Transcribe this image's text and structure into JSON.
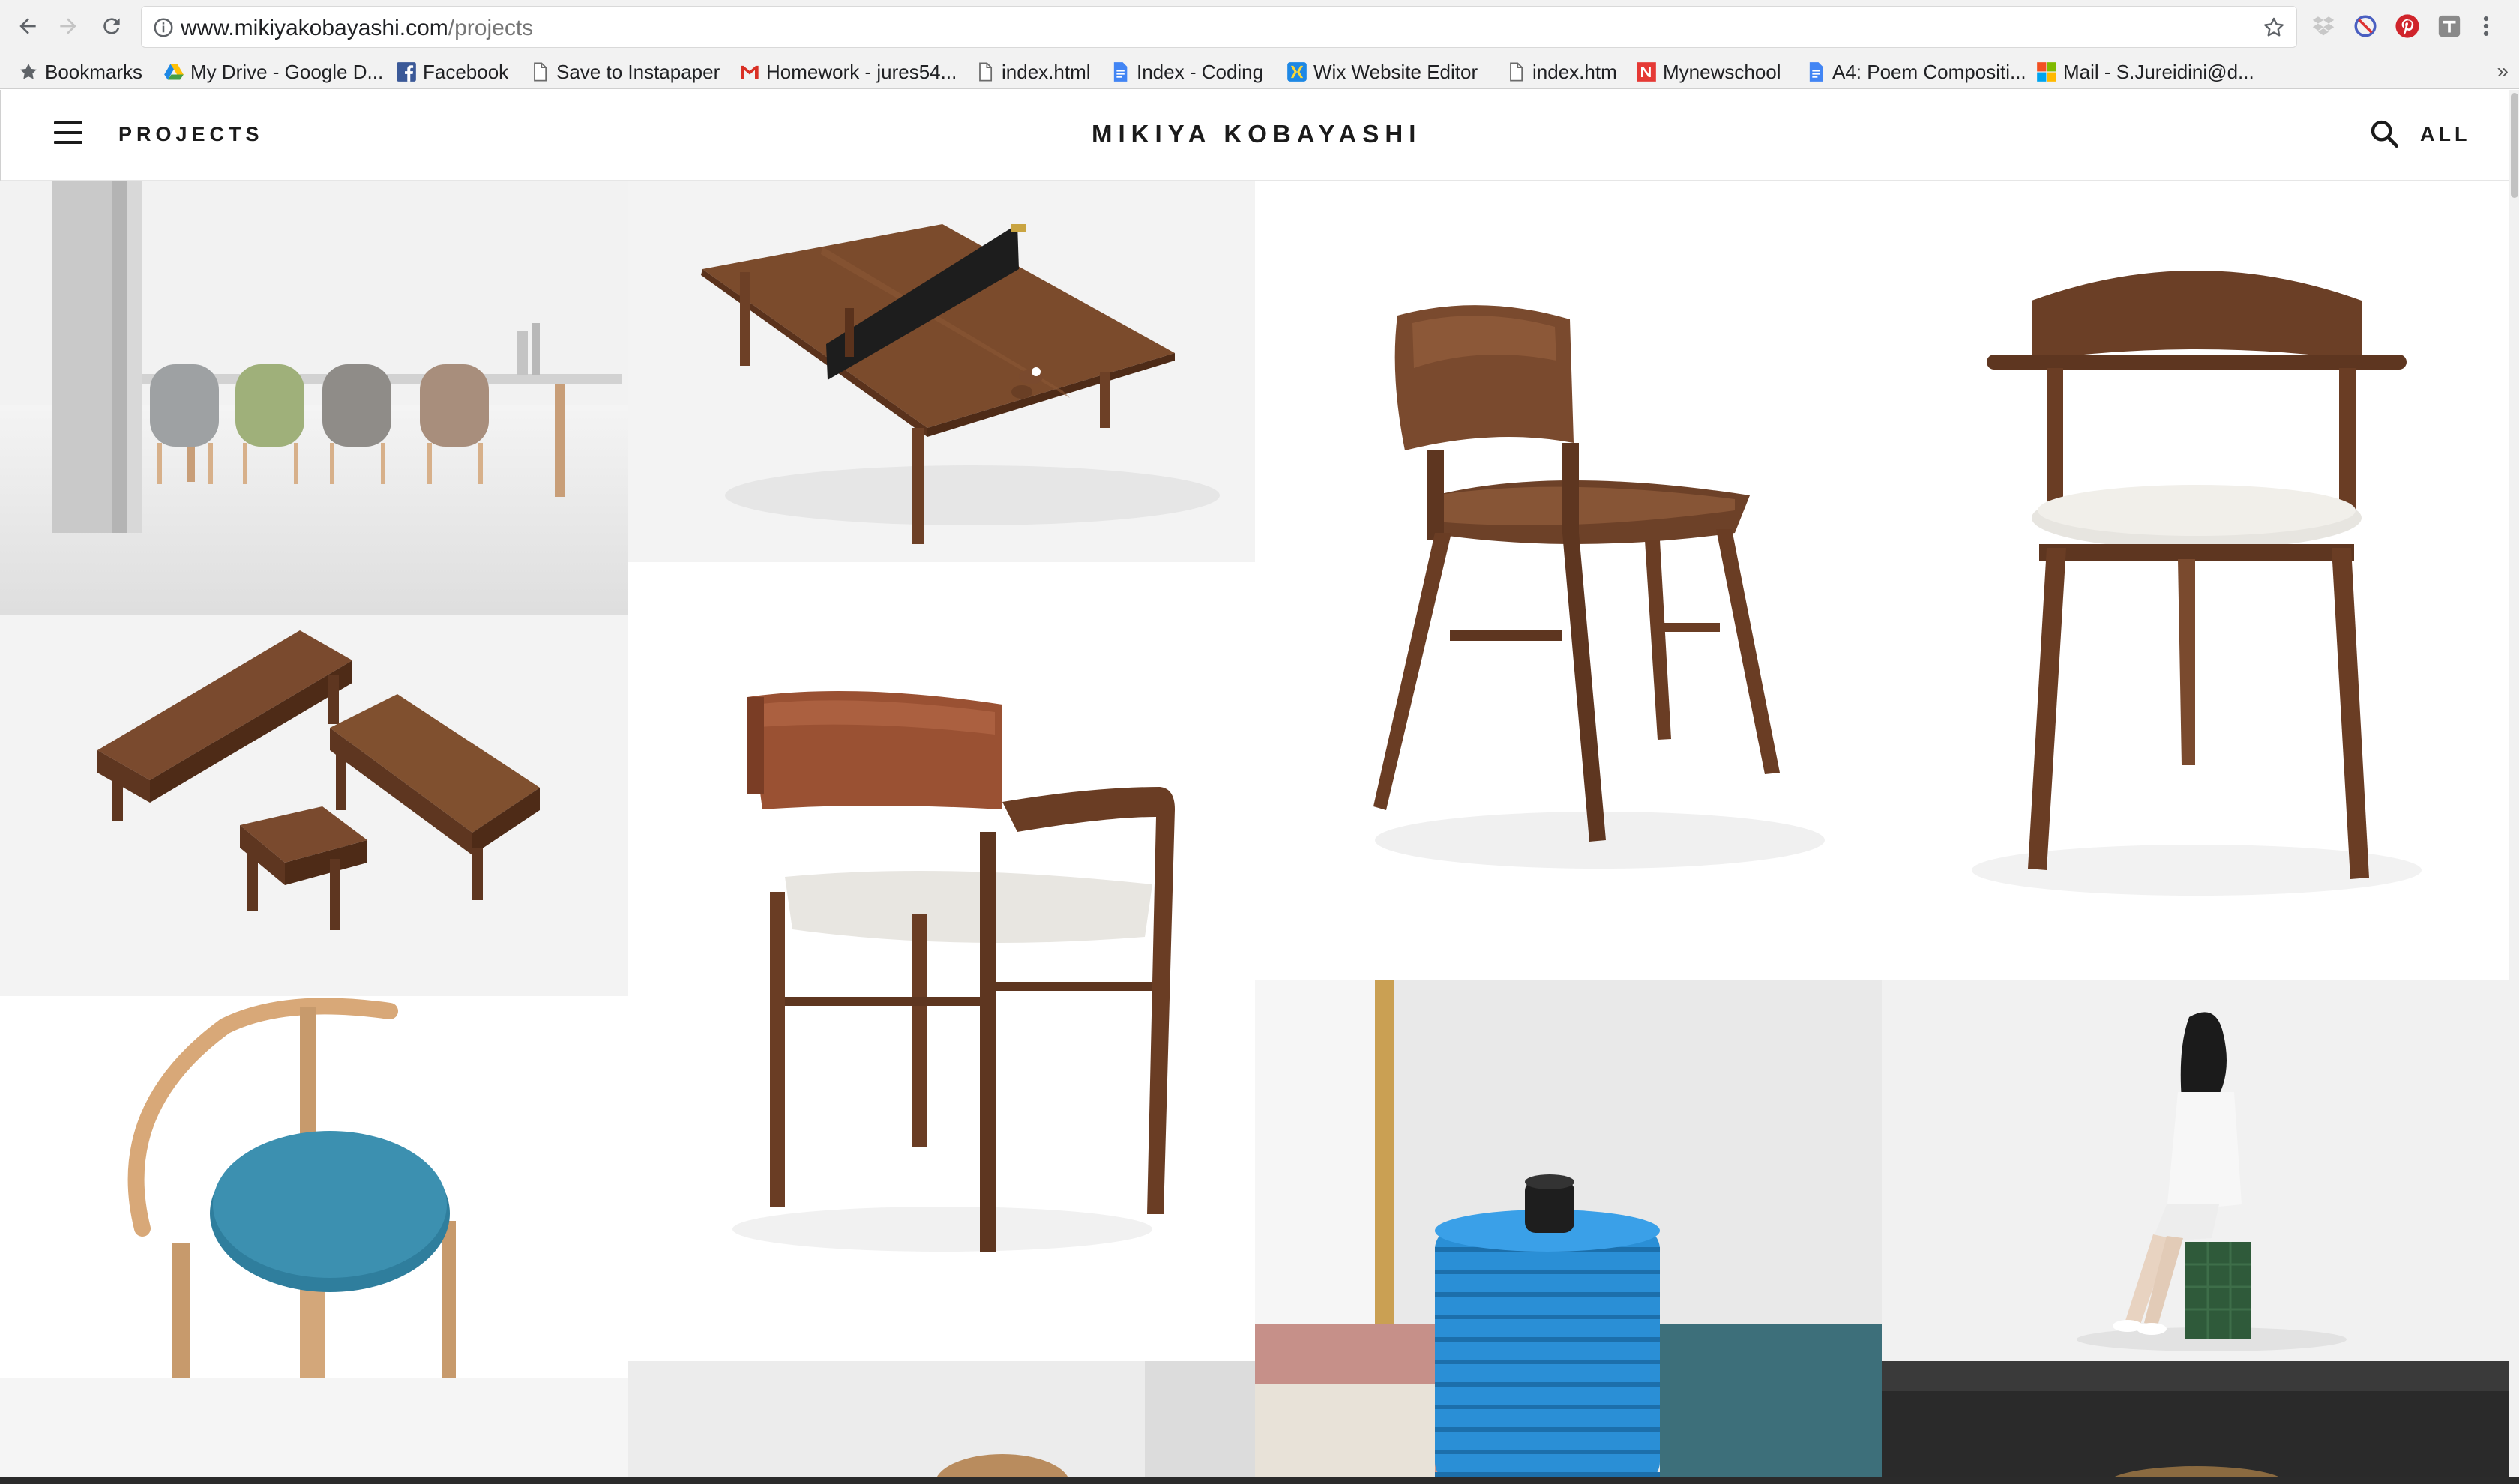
{
  "browser": {
    "url_host": "www.mikiyakobayashi.com",
    "url_path": "/projects",
    "bookmarks": [
      {
        "label": "Bookmarks",
        "icon": "star-icon"
      },
      {
        "label": "My Drive - Google D...",
        "icon": "google-drive-icon"
      },
      {
        "label": "Facebook",
        "icon": "facebook-icon"
      },
      {
        "label": "Save to Instapaper",
        "icon": "page-icon"
      },
      {
        "label": "Homework - jures54...",
        "icon": "gmail-icon"
      },
      {
        "label": "index.html",
        "icon": "page-icon"
      },
      {
        "label": "Index - Coding",
        "icon": "google-docs-icon"
      },
      {
        "label": "Wix Website Editor",
        "icon": "wix-icon"
      },
      {
        "label": "index.htm",
        "icon": "page-icon"
      },
      {
        "label": "Mynewschool",
        "icon": "newschool-icon"
      },
      {
        "label": "A4: Poem Compositi...",
        "icon": "google-docs-icon"
      },
      {
        "label": "Mail - S.Jureidini@d...",
        "icon": "microsoft-icon"
      }
    ],
    "more": "»"
  },
  "site": {
    "nav_label": "PROJECTS",
    "title": "MIKIYA KOBAYASHI",
    "filter_label": "ALL"
  },
  "projects": [
    {
      "subject": "dining-table-chairs-image"
    },
    {
      "subject": "ping-pong-table-image"
    },
    {
      "subject": "walnut-chair-image"
    },
    {
      "subject": "upholstered-armchair-image"
    },
    {
      "subject": "benches-image"
    },
    {
      "subject": "leather-armchair-image"
    },
    {
      "subject": "blue-stool-image"
    },
    {
      "subject": "blue-speaker-image"
    },
    {
      "subject": "woman-on-stool-image"
    }
  ],
  "colors": {
    "walnut": "#7a4a2e",
    "walnut_dark": "#5e3620",
    "leather": "#9a5133",
    "teal": "#3c90b0",
    "speaker_blue": "#2a8fd6",
    "green": "#2f5a3a"
  }
}
